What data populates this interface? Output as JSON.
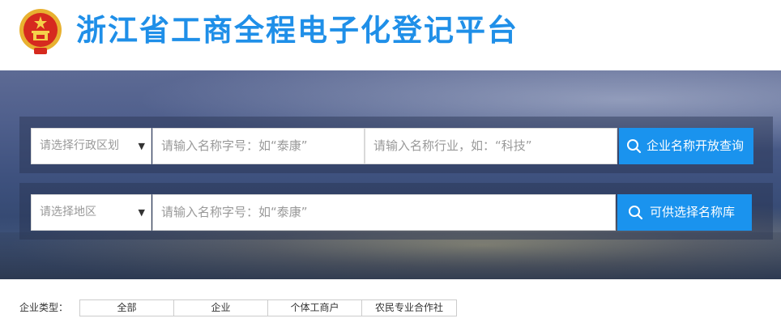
{
  "header": {
    "title": "浙江省工商全程电子化登记平台",
    "emblem_icon": "national-emblem-icon",
    "title_color": "#1f8fe8"
  },
  "search_name_open": {
    "region_select": "请选择行政区划",
    "name_placeholder": "请输入名称字号：如“泰康”",
    "industry_placeholder": "请输入名称行业，如：“科技”",
    "button_label": "企业名称开放查询",
    "button_icon": "search-icon"
  },
  "search_name_library": {
    "area_select": "请选择地区",
    "name_placeholder": "请输入名称字号：如“泰康”",
    "button_label": "可供选择名称库",
    "button_icon": "search-icon"
  },
  "enterprise_type": {
    "label": "企业类型：",
    "tabs": [
      "全部",
      "企业",
      "个体工商户",
      "农民专业合作社"
    ]
  },
  "colors": {
    "accent": "#1a93ee",
    "placeholder": "#999999"
  }
}
